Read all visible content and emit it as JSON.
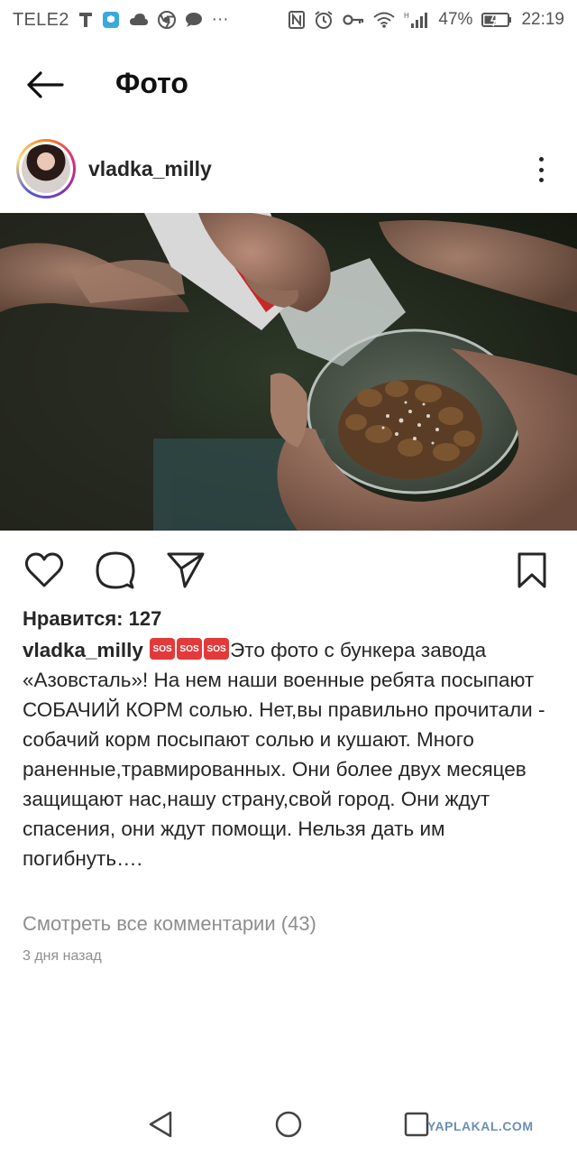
{
  "status_bar": {
    "carrier": "TELE2",
    "battery": "47%",
    "time": "22:19",
    "icons": [
      "t-icon",
      "shield-app-icon",
      "cloud-icon",
      "chrome-icon",
      "chat-icon",
      "more-notifications-icon",
      "nfc-icon",
      "alarm-icon",
      "key-icon",
      "wifi-icon",
      "signal-icon",
      "battery-icon"
    ],
    "more": "···"
  },
  "header": {
    "back_icon": "back-arrow-icon",
    "title": "Фото"
  },
  "post": {
    "username": "vladka_milly",
    "more_icon": "more-vertical-icon",
    "actions": [
      "heart-icon",
      "comment-icon",
      "send-icon",
      "bookmark-icon"
    ],
    "likes": "Нравится: 127",
    "caption_user": "vladka_milly",
    "caption_text": "Это фото с бункера завода «Азовсталь»! На нем наши военные ребята посыпают СОБАЧИЙ КОРМ солью. Нет,вы правильно прочитали - собачий корм посыпают солью и кушают. Много раненные,травмированных. Они более двух месяцев защищают нас,нашу страну,свой город. Они ждут спасения, они ждут помощи. Нельзя дать им погибнуть….",
    "view_comments": "Смотреть все комментарии (43)",
    "timestamp": "3 дня назад"
  },
  "nav": {
    "icons": [
      "nav-back-icon",
      "nav-home-icon",
      "nav-recents-icon"
    ],
    "watermark": "YAPLAKAL.COM"
  }
}
